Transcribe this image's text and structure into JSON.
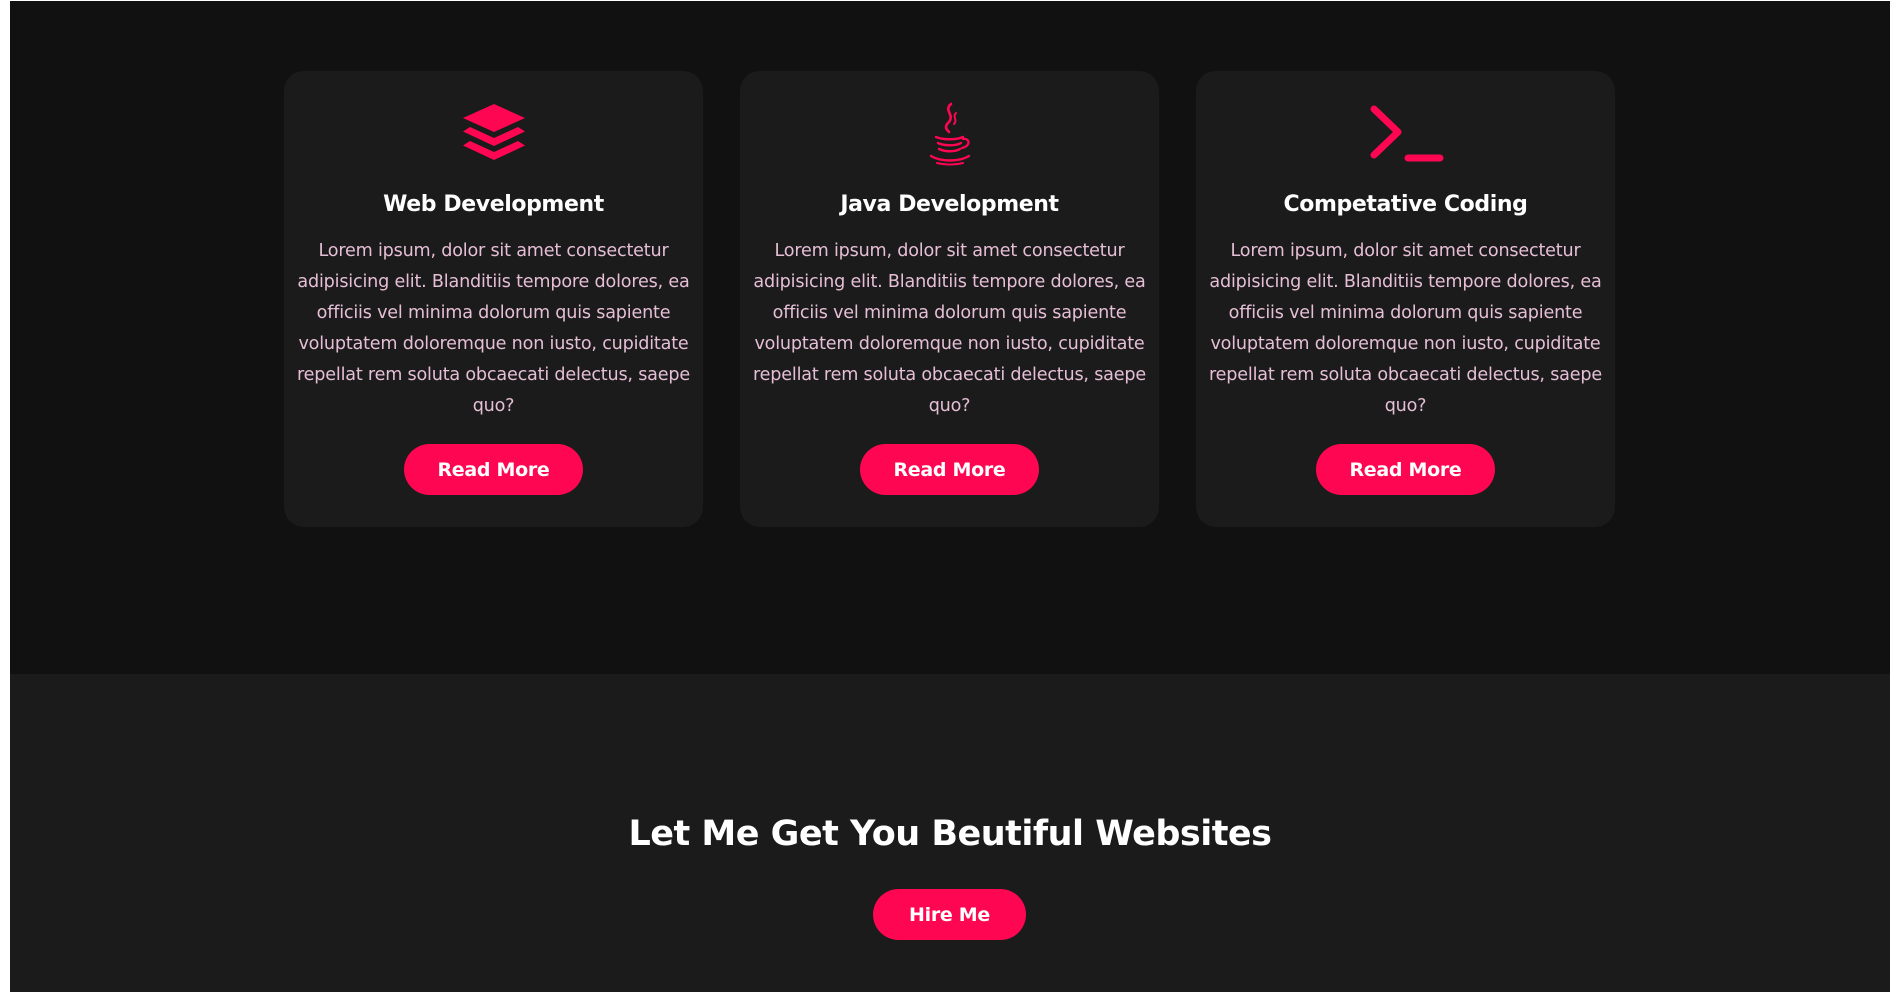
{
  "colors": {
    "accent": "#ff0652",
    "background_dark": "#111111",
    "card_background": "#1b1b1b",
    "body_text": "#e6bfd6",
    "heading_text": "#ffffff"
  },
  "services": {
    "cards": [
      {
        "icon": "layers-icon",
        "title": "Web Development",
        "description": "Lorem ipsum, dolor sit amet consectetur adipisicing elit. Blanditiis tempore dolores, ea officiis vel minima dolorum quis sapiente voluptatem doloremque non iusto, cupiditate repellat rem soluta obcaecati delectus, saepe quo?",
        "button_label": "Read More"
      },
      {
        "icon": "java-coffee-icon",
        "title": "Java Development",
        "description": "Lorem ipsum, dolor sit amet consectetur adipisicing elit. Blanditiis tempore dolores, ea officiis vel minima dolorum quis sapiente voluptatem doloremque non iusto, cupiditate repellat rem soluta obcaecati delectus, saepe quo?",
        "button_label": "Read More"
      },
      {
        "icon": "terminal-icon",
        "title": "Competative Coding",
        "description": "Lorem ipsum, dolor sit amet consectetur adipisicing elit. Blanditiis tempore dolores, ea officiis vel minima dolorum quis sapiente voluptatem doloremque non iusto, cupiditate repellat rem soluta obcaecati delectus, saepe quo?",
        "button_label": "Read More"
      }
    ]
  },
  "cta": {
    "title": "Let Me Get You Beutiful Websites",
    "button_label": "Hire Me"
  }
}
